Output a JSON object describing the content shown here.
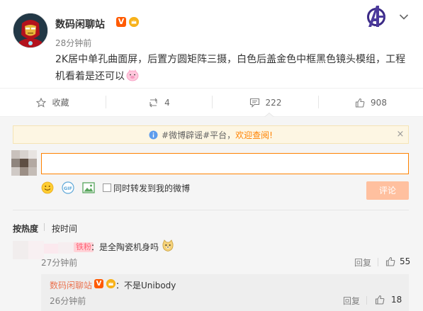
{
  "post": {
    "username": "数码闲聊站",
    "verified_badge": "V",
    "time": "28分钟前",
    "text": "2K居中单孔曲面屏，后置方圆矩阵三摄，白色后盖金色中框黑色镜头模组，工程机看着是还可以"
  },
  "actions": {
    "favorite_label": "收藏",
    "repost_count": "4",
    "comment_count": "222",
    "like_count": "908"
  },
  "notice": {
    "prefix": "#微博辟谣#平台，",
    "highlight": "欢迎查阅!",
    "close": "×"
  },
  "comment_box": {
    "value": "",
    "repost_option_label": "同时转发到我的微博",
    "submit_label": "评论"
  },
  "sort": {
    "hot_label": "按热度",
    "time_label": "按时间"
  },
  "comments": [
    {
      "badge": "铁粉",
      "text": "：是全陶瓷机身吗",
      "time": "27分钟前",
      "reply_label": "回复",
      "likes": "55",
      "replies": [
        {
          "username": "数码闲聊站",
          "badge": "V",
          "text": "：不是Unibody",
          "time": "26分钟前",
          "reply_label": "回复",
          "likes": "18"
        }
      ]
    }
  ],
  "colors": {
    "accent": "#ff8200",
    "username_link": "#eb7350",
    "submit_disabled": "#ffc09f",
    "verified": "#ff5a00"
  },
  "icons": [
    "avengers-logo-icon",
    "chevron-down-icon",
    "star-icon",
    "repost-icon",
    "comment-icon",
    "thumb-up-icon",
    "info-icon",
    "smiley-icon",
    "gif-icon",
    "image-icon"
  ]
}
